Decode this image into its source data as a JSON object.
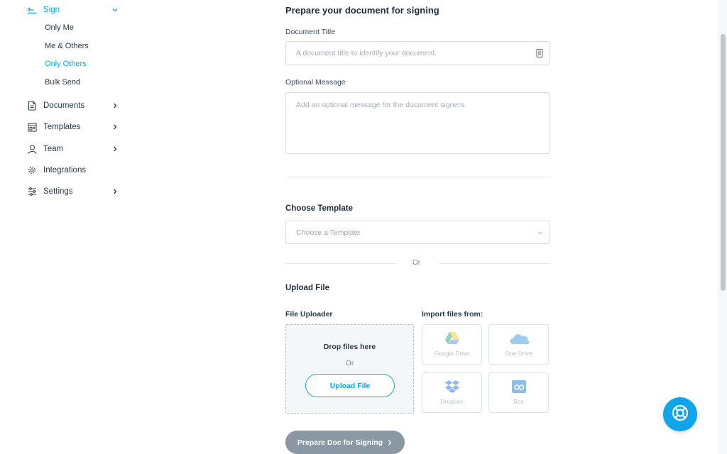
{
  "sidebar": {
    "sign": {
      "label": "Sign",
      "icon": "signature-icon"
    },
    "sign_items": [
      {
        "label": "Only Me",
        "active": false
      },
      {
        "label": "Me & Others",
        "active": false
      },
      {
        "label": "Only Others",
        "active": true
      },
      {
        "label": "Bulk Send",
        "active": false
      }
    ],
    "items": [
      {
        "label": "Documents",
        "icon": "document-icon",
        "has_chevron": true
      },
      {
        "label": "Templates",
        "icon": "template-icon",
        "has_chevron": true
      },
      {
        "label": "Team",
        "icon": "user-icon",
        "has_chevron": true
      },
      {
        "label": "Integrations",
        "icon": "gear-icon",
        "has_chevron": false
      },
      {
        "label": "Settings",
        "icon": "sliders-icon",
        "has_chevron": true
      }
    ]
  },
  "main": {
    "title": "Prepare your document for signing",
    "document_title_label": "Document Title",
    "document_title_placeholder": "A document title to identify your document.",
    "message_label": "Optional Message",
    "message_placeholder": "Add an optional message for the document signers.",
    "choose_template_title": "Choose Template",
    "template_select_value": "Choose a Template",
    "or_text": "Or",
    "upload_file_title": "Upload File",
    "file_uploader_label": "File Uploader",
    "import_label": "Import files from:",
    "drop_title": "Drop files here",
    "drop_or": "Or",
    "upload_button": "Upload File",
    "import_sources": [
      {
        "label": "Google Drive",
        "icon": "google-drive-icon"
      },
      {
        "label": "One Drive",
        "icon": "onedrive-icon"
      },
      {
        "label": "Dropbox",
        "icon": "dropbox-icon"
      },
      {
        "label": "Box",
        "icon": "box-icon"
      }
    ],
    "submit_button": "Prepare Doc for Signing"
  },
  "colors": {
    "accent": "#0ea5e9",
    "text": "#1f2d3d",
    "submit_disabled": "#8a97a4"
  }
}
